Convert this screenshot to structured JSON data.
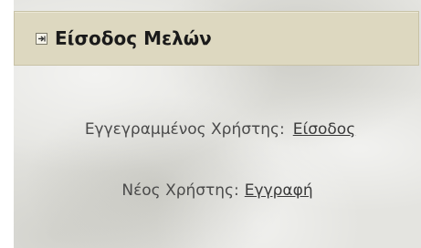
{
  "panel": {
    "title": "Είσοδος Μελών",
    "icon": "login-arrow-icon"
  },
  "registered_user": {
    "label": "Εγγεγραμμένος Χρήστης:",
    "link_text": "Είσοδος"
  },
  "new_user": {
    "label": "Νέος Χρήστης:",
    "link_text": "Εγγραφή"
  },
  "colors": {
    "header_background": "#ddd8c0",
    "panel_background": "#e4e4e0",
    "text": "#4a4a4a"
  }
}
